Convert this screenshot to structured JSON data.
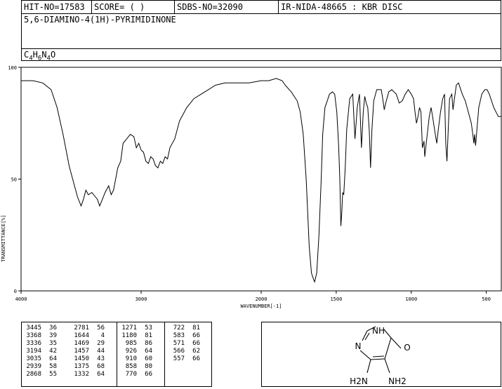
{
  "header": {
    "hit_no": "HIT-NO=17583",
    "score": "SCORE=  (   )",
    "sdbs_no": "SDBS-NO=32090",
    "ir_info": "IR-NIDA-48665 : KBR DISC",
    "compound_name": "5,6-DIAMINO-4(1H)-PYRIMIDINONE",
    "formula": {
      "c": "C",
      "c_n": "4",
      "h": "H",
      "h_n": "6",
      "n": "N",
      "n_n": "4",
      "o": "O"
    }
  },
  "chart_data": {
    "type": "line",
    "xlabel": "WAVENUMBER[-1]",
    "ylabel": "TRANSMITTANCE[%]",
    "xlim": [
      4000,
      400
    ],
    "ylim": [
      0,
      100
    ],
    "x_ticks": [
      "4000",
      "3000",
      "2000",
      "1500",
      "1000",
      "500"
    ],
    "y_ticks": [
      "100",
      "50",
      "0"
    ],
    "series": [
      {
        "color": "#000000",
        "points": [
          [
            4000,
            94
          ],
          [
            3900,
            94
          ],
          [
            3820,
            93
          ],
          [
            3750,
            90
          ],
          [
            3700,
            82
          ],
          [
            3650,
            70
          ],
          [
            3600,
            56
          ],
          [
            3560,
            48
          ],
          [
            3530,
            42
          ],
          [
            3500,
            38
          ],
          [
            3480,
            41
          ],
          [
            3460,
            45
          ],
          [
            3440,
            43
          ],
          [
            3410,
            44
          ],
          [
            3380,
            42
          ],
          [
            3365,
            41
          ],
          [
            3345,
            38
          ],
          [
            3330,
            40
          ],
          [
            3300,
            44
          ],
          [
            3270,
            47
          ],
          [
            3250,
            43
          ],
          [
            3230,
            45
          ],
          [
            3195,
            55
          ],
          [
            3170,
            58
          ],
          [
            3150,
            66
          ],
          [
            3120,
            68
          ],
          [
            3090,
            70
          ],
          [
            3060,
            69
          ],
          [
            3040,
            64
          ],
          [
            3020,
            66
          ],
          [
            3000,
            63
          ],
          [
            2980,
            62
          ],
          [
            2960,
            58
          ],
          [
            2940,
            57
          ],
          [
            2920,
            60
          ],
          [
            2900,
            59
          ],
          [
            2880,
            56
          ],
          [
            2860,
            55
          ],
          [
            2840,
            58
          ],
          [
            2820,
            57
          ],
          [
            2800,
            60
          ],
          [
            2780,
            59
          ],
          [
            2760,
            64
          ],
          [
            2720,
            68
          ],
          [
            2680,
            76
          ],
          [
            2620,
            82
          ],
          [
            2560,
            86
          ],
          [
            2500,
            88
          ],
          [
            2440,
            90
          ],
          [
            2380,
            92
          ],
          [
            2300,
            93
          ],
          [
            2200,
            93
          ],
          [
            2100,
            93
          ],
          [
            2000,
            94
          ],
          [
            1950,
            94
          ],
          [
            1900,
            95
          ],
          [
            1860,
            94
          ],
          [
            1840,
            92
          ],
          [
            1800,
            89
          ],
          [
            1760,
            85
          ],
          [
            1740,
            80
          ],
          [
            1720,
            70
          ],
          [
            1700,
            50
          ],
          [
            1680,
            20
          ],
          [
            1665,
            8
          ],
          [
            1650,
            5
          ],
          [
            1644,
            4
          ],
          [
            1630,
            8
          ],
          [
            1615,
            25
          ],
          [
            1600,
            50
          ],
          [
            1590,
            70
          ],
          [
            1575,
            82
          ],
          [
            1560,
            85
          ],
          [
            1545,
            88
          ],
          [
            1525,
            89
          ],
          [
            1510,
            88
          ],
          [
            1496,
            80
          ],
          [
            1484,
            65
          ],
          [
            1476,
            50
          ],
          [
            1469,
            29
          ],
          [
            1463,
            35
          ],
          [
            1457,
            44
          ],
          [
            1450,
            43
          ],
          [
            1440,
            55
          ],
          [
            1430,
            72
          ],
          [
            1410,
            86
          ],
          [
            1390,
            88
          ],
          [
            1375,
            68
          ],
          [
            1360,
            82
          ],
          [
            1345,
            88
          ],
          [
            1332,
            64
          ],
          [
            1320,
            80
          ],
          [
            1310,
            87
          ],
          [
            1300,
            84
          ],
          [
            1290,
            82
          ],
          [
            1280,
            72
          ],
          [
            1271,
            55
          ],
          [
            1262,
            72
          ],
          [
            1250,
            85
          ],
          [
            1230,
            90
          ],
          [
            1200,
            90
          ],
          [
            1190,
            86
          ],
          [
            1180,
            81
          ],
          [
            1170,
            84
          ],
          [
            1150,
            89
          ],
          [
            1130,
            90
          ],
          [
            1100,
            88
          ],
          [
            1080,
            84
          ],
          [
            1060,
            85
          ],
          [
            1040,
            88
          ],
          [
            1020,
            90
          ],
          [
            1000,
            88
          ],
          [
            985,
            86
          ],
          [
            975,
            80
          ],
          [
            965,
            75
          ],
          [
            955,
            78
          ],
          [
            945,
            82
          ],
          [
            935,
            80
          ],
          [
            926,
            64
          ],
          [
            915,
            67
          ],
          [
            910,
            60
          ],
          [
            900,
            66
          ],
          [
            880,
            78
          ],
          [
            868,
            82
          ],
          [
            858,
            78
          ],
          [
            840,
            70
          ],
          [
            830,
            66
          ],
          [
            820,
            72
          ],
          [
            805,
            80
          ],
          [
            790,
            86
          ],
          [
            778,
            88
          ],
          [
            770,
            66
          ],
          [
            762,
            58
          ],
          [
            752,
            75
          ],
          [
            745,
            86
          ],
          [
            730,
            88
          ],
          [
            722,
            81
          ],
          [
            712,
            86
          ],
          [
            700,
            92
          ],
          [
            685,
            93
          ],
          [
            675,
            91
          ],
          [
            660,
            88
          ],
          [
            640,
            85
          ],
          [
            620,
            80
          ],
          [
            600,
            75
          ],
          [
            590,
            70
          ],
          [
            583,
            66
          ],
          [
            578,
            70
          ],
          [
            571,
            65
          ],
          [
            565,
            70
          ],
          [
            550,
            82
          ],
          [
            530,
            88
          ],
          [
            510,
            90
          ],
          [
            495,
            90
          ],
          [
            480,
            88
          ],
          [
            465,
            85
          ],
          [
            450,
            82
          ],
          [
            435,
            80
          ],
          [
            420,
            78
          ],
          [
            405,
            78
          ],
          [
            400,
            78
          ]
        ]
      }
    ]
  },
  "peak_table": {
    "columns": [
      [
        [
          "3445",
          "36"
        ],
        [
          "3368",
          "39"
        ],
        [
          "3336",
          "35"
        ],
        [
          "3194",
          "42"
        ],
        [
          "3035",
          "64"
        ],
        [
          "2939",
          "58"
        ],
        [
          "2868",
          "55"
        ]
      ],
      [
        [
          "2781",
          "56"
        ],
        [
          "1644",
          "4"
        ],
        [
          "1469",
          "29"
        ],
        [
          "1457",
          "44"
        ],
        [
          "1450",
          "43"
        ],
        [
          "1375",
          "68"
        ],
        [
          "1332",
          "64"
        ]
      ],
      [
        [
          "1271",
          "53"
        ],
        [
          "1180",
          "81"
        ],
        [
          "985",
          "86"
        ],
        [
          "926",
          "64"
        ],
        [
          "910",
          "60"
        ],
        [
          "858",
          "80"
        ],
        [
          "770",
          "66"
        ]
      ],
      [
        [
          "722",
          "81"
        ],
        [
          "583",
          "66"
        ],
        [
          "571",
          "66"
        ],
        [
          "566",
          "62"
        ],
        [
          "557",
          "66"
        ]
      ]
    ]
  },
  "structure": {
    "labels": {
      "nh": "NH",
      "n": "N",
      "o": "O",
      "h2n": "H2N",
      "nh2": "NH2"
    }
  }
}
